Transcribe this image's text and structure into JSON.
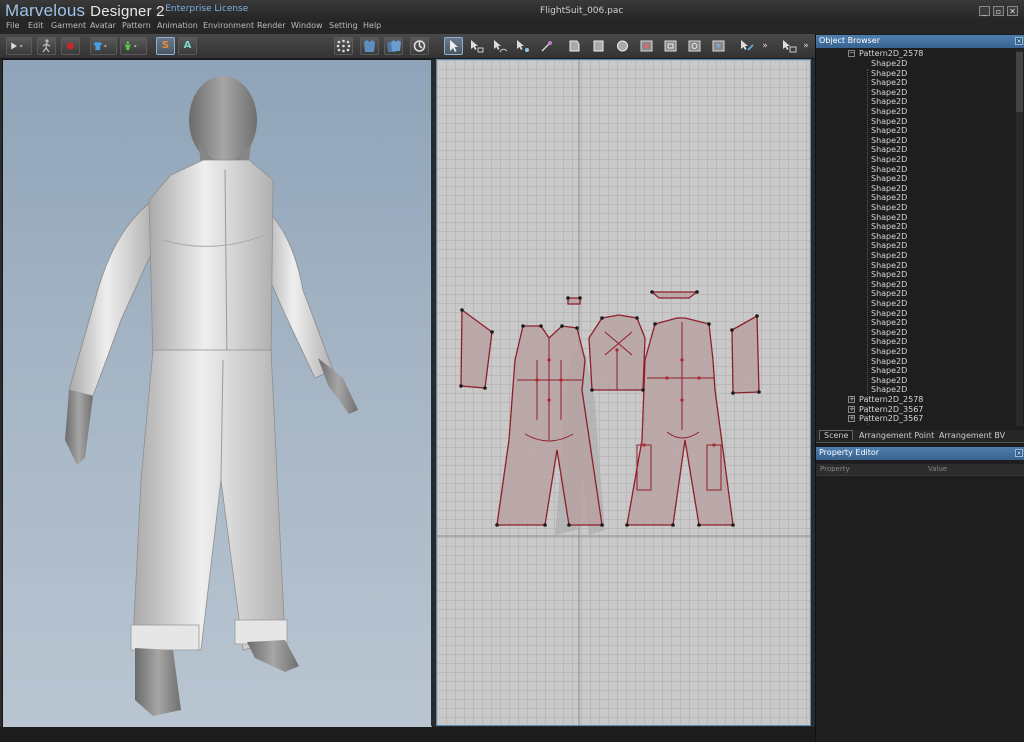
{
  "app": {
    "name_main": "Marvelous",
    "name_sub": "Designer 2",
    "license": "Enterprise License",
    "file_name": "FlightSuit_006.pac"
  },
  "window_controls": {
    "minimize": "_",
    "restore": "▫",
    "close": "✕"
  },
  "menu": [
    "File",
    "Edit",
    "Garment",
    "Avatar",
    "Pattern",
    "Animation",
    "Environment",
    "Render",
    "Window",
    "Setting",
    "Help"
  ],
  "toolbar": {
    "simulate_label": "S",
    "avatar_label": "A",
    "more_label": "»"
  },
  "object_browser": {
    "title": "Object Browser",
    "expanded_pattern": "Pattern2D_2578",
    "shapes": [
      "Shape2D",
      "Shape2D",
      "Shape2D",
      "Shape2D",
      "Shape2D",
      "Shape2D",
      "Shape2D",
      "Shape2D",
      "Shape2D",
      "Shape2D",
      "Shape2D",
      "Shape2D",
      "Shape2D",
      "Shape2D",
      "Shape2D",
      "Shape2D",
      "Shape2D",
      "Shape2D",
      "Shape2D",
      "Shape2D",
      "Shape2D",
      "Shape2D",
      "Shape2D",
      "Shape2D",
      "Shape2D",
      "Shape2D",
      "Shape2D",
      "Shape2D",
      "Shape2D",
      "Shape2D",
      "Shape2D",
      "Shape2D",
      "Shape2D",
      "Shape2D",
      "Shape2D"
    ],
    "collapsed_patterns": [
      "Pattern2D_2578",
      "Pattern2D_3567",
      "Pattern2D_3567"
    ]
  },
  "tabs": [
    "Scene",
    "Arrangement Point",
    "Arrangement BV"
  ],
  "property_editor": {
    "title": "Property Editor",
    "col_property": "Property",
    "col_value": "Value"
  },
  "colors": {
    "accent": "#4f7fae",
    "pattern_fill": "#b8a0a0",
    "pattern_stroke": "#8e1f2a"
  }
}
